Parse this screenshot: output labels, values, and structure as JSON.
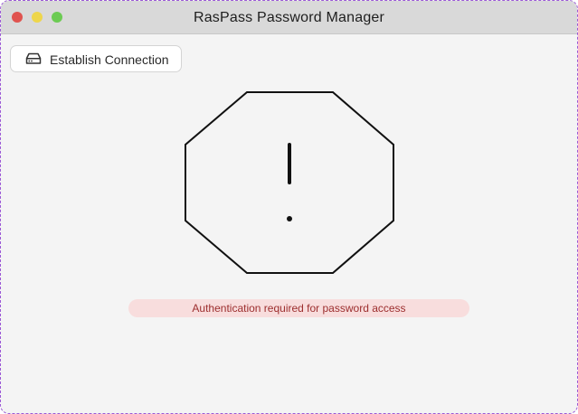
{
  "window": {
    "title": "RasPass Password Manager",
    "controls": {
      "close_color": "#e0534f",
      "minimize_color": "#eed64b",
      "maximize_color": "#6ccb53"
    }
  },
  "toolbar": {
    "connect_label": "Establish Connection",
    "connect_icon": "hard-drive-icon"
  },
  "main": {
    "status_icon": "octagon-alert-icon",
    "alert_message": "Authentication required for password access",
    "alert_colors": {
      "background": "#f8dddd",
      "text": "#9c2e2e"
    }
  }
}
